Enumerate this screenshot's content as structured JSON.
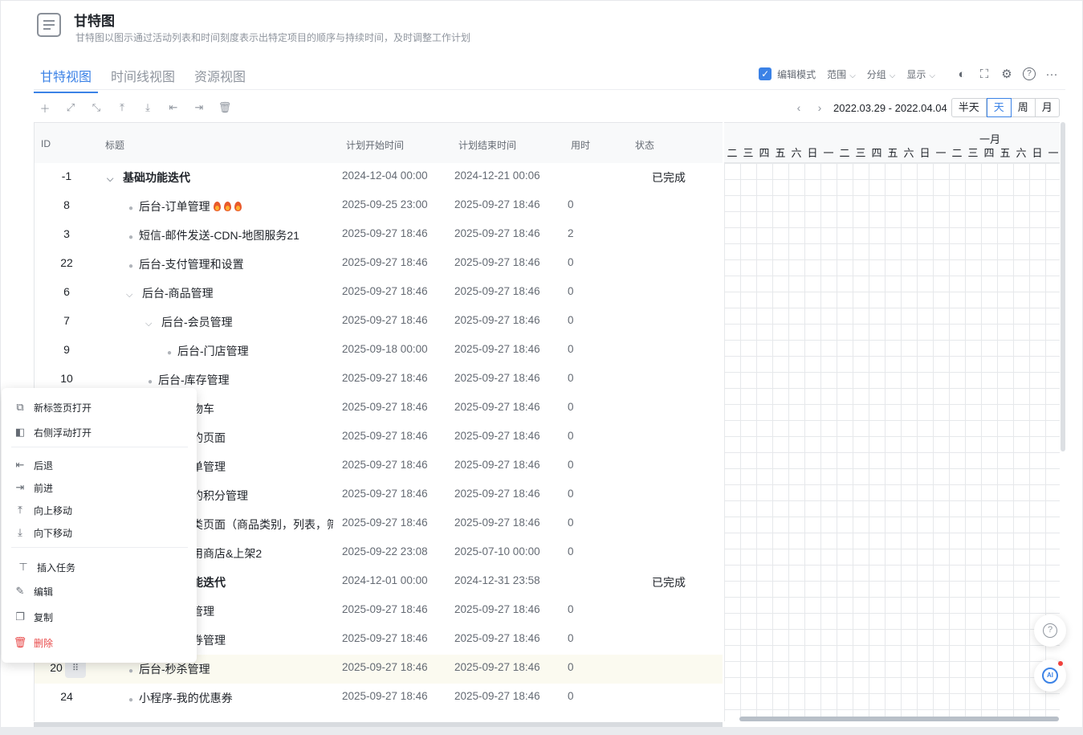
{
  "header": {
    "title": "甘特图",
    "description": "甘特图以图示通过活动列表和时间刻度表示出特定项目的顺序与持续时间，及时调整工作计划"
  },
  "tabs": [
    {
      "label": "甘特视图",
      "active": true
    },
    {
      "label": "时间线视图",
      "active": false
    },
    {
      "label": "资源视图",
      "active": false
    }
  ],
  "controls": {
    "edit_mode_label": "编辑模式",
    "edit_mode_checked": true,
    "range_label": "范围",
    "group_label": "分组",
    "display_label": "显示"
  },
  "date_nav": {
    "range": "2022.03.29 - 2022.04.04",
    "scales": [
      "半天",
      "天",
      "周",
      "月"
    ],
    "active_scale": "天"
  },
  "columns": {
    "id": "ID",
    "title": "标题",
    "start": "计划开始时间",
    "end": "计划结束时间",
    "time": "用时",
    "status": "状态"
  },
  "rows": [
    {
      "id": "-1",
      "title": "基础功能迭代",
      "start": "2024-12-04 00:00",
      "end": "2024-12-21 00:06",
      "time": "",
      "status": "已完成"
    },
    {
      "id": "8",
      "title": "后台-订单管理",
      "start": "2025-09-25 23:00",
      "end": "2025-09-27 18:46",
      "time": "0",
      "status": ""
    },
    {
      "id": "3",
      "title": "短信-邮件发送-CDN-地图服务21",
      "start": "2025-09-27 18:46",
      "end": "2025-09-27 18:46",
      "time": "2",
      "status": ""
    },
    {
      "id": "22",
      "title": "后台-支付管理和设置",
      "start": "2025-09-27 18:46",
      "end": "2025-09-27 18:46",
      "time": "0",
      "status": ""
    },
    {
      "id": "6",
      "title": "后台-商品管理",
      "start": "2025-09-27 18:46",
      "end": "2025-09-27 18:46",
      "time": "0",
      "status": ""
    },
    {
      "id": "7",
      "title": "后台-会员管理",
      "start": "2025-09-27 18:46",
      "end": "2025-09-27 18:46",
      "time": "0",
      "status": ""
    },
    {
      "id": "9",
      "title": "后台-门店管理",
      "start": "2025-09-18 00:00",
      "end": "2025-09-27 18:46",
      "time": "0",
      "status": ""
    },
    {
      "id": "10",
      "title": "后台-库存管理",
      "start": "2025-09-27 18:46",
      "end": "2025-09-27 18:46",
      "time": "0",
      "status": ""
    },
    {
      "id": "",
      "title": "物车",
      "start": "2025-09-27 18:46",
      "end": "2025-09-27 18:46",
      "time": "0",
      "status": ""
    },
    {
      "id": "",
      "title": "的页面",
      "start": "2025-09-27 18:46",
      "end": "2025-09-27 18:46",
      "time": "0",
      "status": ""
    },
    {
      "id": "",
      "title": "单管理",
      "start": "2025-09-27 18:46",
      "end": "2025-09-27 18:46",
      "time": "0",
      "status": ""
    },
    {
      "id": "",
      "title": "的积分管理",
      "start": "2025-09-27 18:46",
      "end": "2025-09-27 18:46",
      "time": "0",
      "status": ""
    },
    {
      "id": "",
      "title": "类页面（商品类别，列表，筛",
      "start": "2025-09-27 18:46",
      "end": "2025-09-27 18:46",
      "time": "0",
      "status": ""
    },
    {
      "id": "",
      "title": "用商店&上架2",
      "start": "2025-09-22 23:08",
      "end": "2025-07-10 00:00",
      "time": "0",
      "status": ""
    },
    {
      "id": "",
      "title": "能迭代",
      "start": "2024-12-01 00:00",
      "end": "2024-12-31 23:58",
      "time": "",
      "status": "已完成"
    },
    {
      "id": "",
      "title": "管理",
      "start": "2025-09-27 18:46",
      "end": "2025-09-27 18:46",
      "time": "0",
      "status": ""
    },
    {
      "id": "",
      "title": "券管理",
      "start": "2025-09-27 18:46",
      "end": "2025-09-27 18:46",
      "time": "0",
      "status": ""
    },
    {
      "id": "20",
      "title": "后台-秒杀管理",
      "start": "2025-09-27 18:46",
      "end": "2025-09-27 18:46",
      "time": "0",
      "status": ""
    },
    {
      "id": "24",
      "title": "小程序-我的优惠券",
      "start": "2025-09-27 18:46",
      "end": "2025-09-27 18:46",
      "time": "0",
      "status": ""
    }
  ],
  "gantt": {
    "month": "一月",
    "days": [
      "二",
      "三",
      "四",
      "五",
      "六",
      "日",
      "一",
      "二",
      "三",
      "四",
      "五",
      "六",
      "日",
      "一",
      "二",
      "三",
      "四",
      "五",
      "六",
      "日",
      "一"
    ]
  },
  "context_menu": {
    "open_new_tab": "新标签页打开",
    "open_right_float": "右侧浮动打开",
    "back": "后退",
    "forward": "前进",
    "move_up": "向上移动",
    "move_down": "向下移动",
    "insert_task": "插入任务",
    "edit": "编辑",
    "copy": "复制",
    "delete": "删除"
  },
  "colors": {
    "accent": "#3b82e6",
    "danger": "#e84a4a"
  }
}
